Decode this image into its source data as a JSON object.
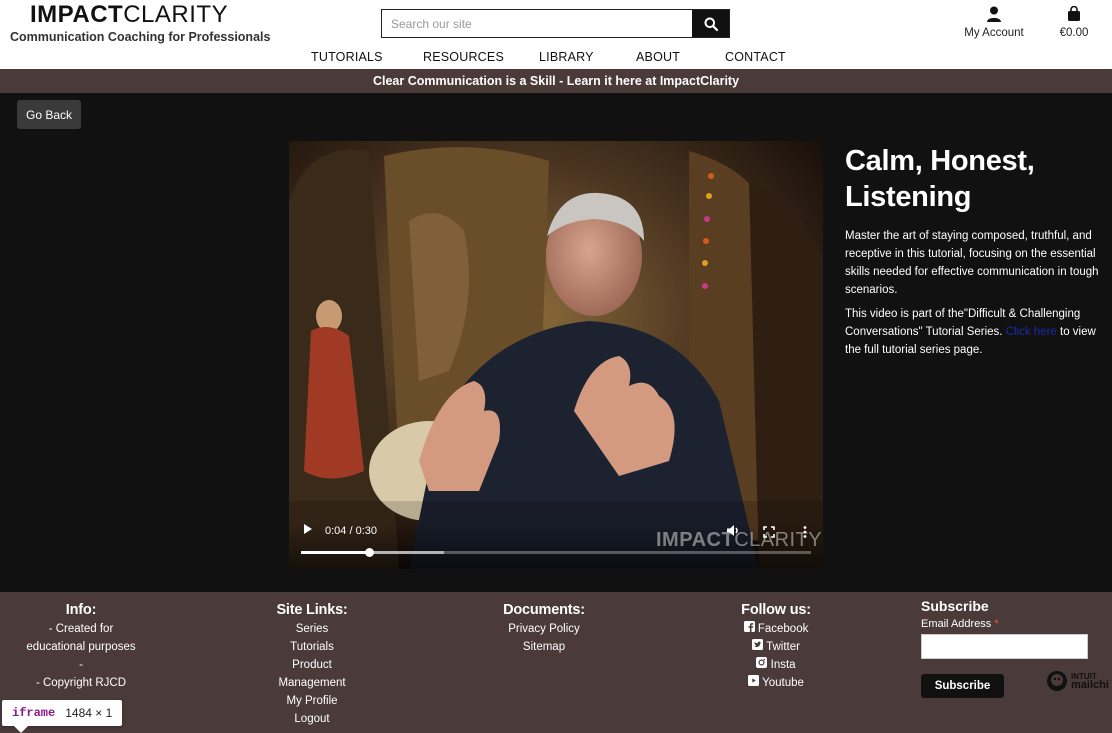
{
  "header": {
    "logo_bold": "IMPACT",
    "logo_light": "CLARITY",
    "tagline": "Communication Coaching for Professionals",
    "search_placeholder": "Search our site",
    "account_label": "My Account",
    "cart_total": "€0.00",
    "nav": [
      "TUTORIALS",
      "RESOURCES",
      "LIBRARY",
      "ABOUT",
      "CONTACT"
    ]
  },
  "banner": "Clear Communication is a Skill - Learn it here at ImpactClarity",
  "go_back": "Go Back",
  "video": {
    "time": "0:04 / 0:30",
    "progress": 0.1333,
    "buffered": 0.28,
    "watermark_bold": "IMPACT",
    "watermark_light": "CLARITY"
  },
  "tutorial": {
    "title": "Calm, Honest, Listening",
    "description": "Master the art of staying composed, truthful, and receptive in this tutorial, focusing on the essential skills needed for effective communication in tough scenarios.",
    "series_pre": "This video is part of the\"Difficult & Challenging Conversations\" Tutorial Series. ",
    "series_link": "Click here",
    "series_post": " to view the full tutorial series page."
  },
  "footer": {
    "info": {
      "title": "Info:",
      "lines": [
        "- Created for",
        "educational purposes",
        "-",
        "- Copyright RJCD"
      ]
    },
    "site_links": {
      "title": "Site Links:",
      "links": [
        "Series",
        "Tutorials",
        "Product",
        "Management",
        "My Profile",
        "Logout"
      ]
    },
    "documents": {
      "title": "Documents:",
      "links": [
        "Privacy Policy",
        "Sitemap"
      ]
    },
    "follow": {
      "title": "Follow us:",
      "links": [
        "Facebook",
        "Twitter",
        "Insta",
        "Youtube"
      ]
    },
    "subscribe": {
      "title": "Subscribe",
      "email_label": "Email Address",
      "required_mark": "*",
      "button": "Subscribe",
      "badge_top": "INTUIT",
      "badge_bottom": "mailchi"
    }
  },
  "devtools_tip": {
    "tag": "iframe",
    "size": "1484 × 1"
  }
}
